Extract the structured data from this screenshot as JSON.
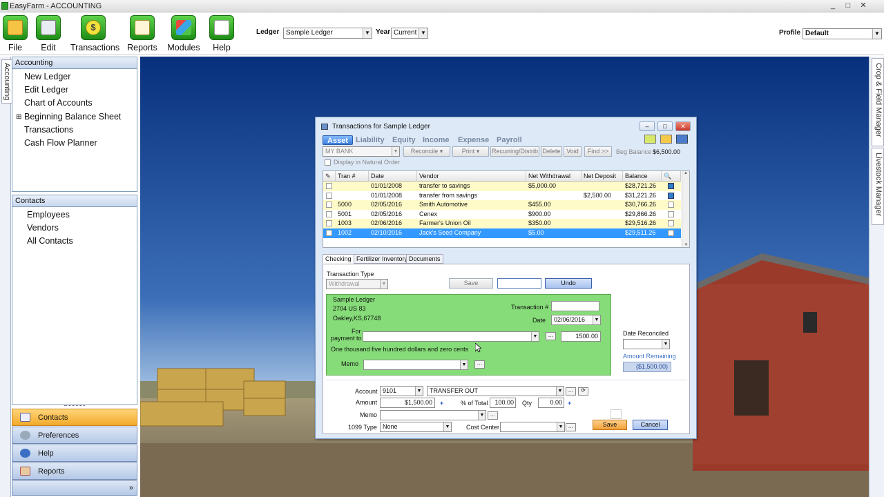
{
  "app": {
    "title": "EasyFarm - ACCOUNTING",
    "win_min": "_",
    "win_max": "□",
    "win_close": "✕"
  },
  "toolbar": {
    "buttons": [
      {
        "label": "File",
        "icon": "folder-icon"
      },
      {
        "label": "Edit",
        "icon": "clipboard-icon"
      },
      {
        "label": "Transactions",
        "icon": "dollar-icon"
      },
      {
        "label": "Reports",
        "icon": "report-icon"
      },
      {
        "label": "Modules",
        "icon": "cubes-icon"
      },
      {
        "label": "Help",
        "icon": "help-icon"
      }
    ],
    "ledger_label": "Ledger",
    "ledger_value": "Sample Ledger",
    "year_label": "Year",
    "year_value": "Current",
    "profile_label": "Profile",
    "profile_value": "Default"
  },
  "left_tab": {
    "label": "Accounting"
  },
  "accounting_panel": {
    "header": "Accounting",
    "items": [
      "New Ledger",
      "Edit Ledger",
      "Chart of Accounts",
      "Beginning Balance Sheet",
      "Transactions",
      "Cash Flow Planner"
    ],
    "expander": "⊞"
  },
  "contacts_panel": {
    "header": "Contacts",
    "items": [
      "Employees",
      "Vendors",
      "All Contacts"
    ]
  },
  "nav_buttons": [
    {
      "label": "Contacts",
      "active": true
    },
    {
      "label": "Preferences",
      "active": false
    },
    {
      "label": "Help",
      "active": false
    },
    {
      "label": "Reports",
      "active": false
    }
  ],
  "nav_more": "»",
  "right_tabs": [
    "Crop & Field Manager",
    "Livestock Manager"
  ],
  "dialog": {
    "title": "Transactions for Sample Ledger",
    "tabs": [
      "Asset",
      "Liability",
      "Equity",
      "Income",
      "Expense",
      "Payroll"
    ],
    "account_select": "MY BANK",
    "tool_buttons": [
      "Reconcile",
      "Print",
      "Recurring/Distrib",
      "Delete",
      "Void",
      "Find >>"
    ],
    "beg_balance_label": "Beg Balance",
    "beg_balance_value": "$6,500.00",
    "natural_order_label": "Display in Natural Order",
    "columns": [
      "Tran #",
      "Date",
      "Vendor",
      "Net Withdrawal",
      "Net Deposit",
      "Balance"
    ],
    "rows": [
      {
        "tran": "",
        "date": "01/01/2008",
        "vendor": "transfer to savings",
        "withdrawal": "$5,000.00",
        "deposit": "",
        "balance": "$28,721.26",
        "marked": true,
        "style": "yellow"
      },
      {
        "tran": "",
        "date": "01/01/2008",
        "vendor": "transfer from savings",
        "withdrawal": "",
        "deposit": "$2,500.00",
        "balance": "$31,221.26",
        "marked": true,
        "style": "white"
      },
      {
        "tran": "5000",
        "date": "02/05/2016",
        "vendor": "Smith Automotive",
        "withdrawal": "$455.00",
        "deposit": "",
        "balance": "$30,766.26",
        "marked": false,
        "style": "yellow"
      },
      {
        "tran": "5001",
        "date": "02/05/2016",
        "vendor": "Cenex",
        "withdrawal": "$900.00",
        "deposit": "",
        "balance": "$29,866.26",
        "marked": false,
        "style": "white"
      },
      {
        "tran": "1003",
        "date": "02/06/2016",
        "vendor": "Farmer's Union Oil",
        "withdrawal": "$350.00",
        "deposit": "",
        "balance": "$29,516.26",
        "marked": false,
        "style": "yellow"
      },
      {
        "tran": "1002",
        "date": "02/10/2016",
        "vendor": "Jack's Seed Company",
        "withdrawal": "$5.00",
        "deposit": "",
        "balance": "$29,511.26",
        "marked": false,
        "style": "selected"
      }
    ],
    "subtabs": [
      "Checking",
      "Fertilizer Inventory",
      "Documents"
    ],
    "transaction_type_label": "Transaction Type",
    "transaction_type_value": "Withdrawal",
    "save_top": "Save",
    "undo": "Undo",
    "check": {
      "name": "Sample Ledger",
      "address1": "2704 US 83",
      "address2": "Oakley,KS,67748",
      "transaction_no_label": "Transaction #",
      "transaction_no_value": "",
      "date_label": "Date",
      "date_value": "02/06/2016",
      "for_payment_label1": "For",
      "for_payment_label2": "payment to",
      "payee_value": "",
      "amount_value": "1500.00",
      "amount_words": "One thousand five hundred dollars and zero cents",
      "memo_label": "Memo",
      "memo_value": ""
    },
    "date_reconciled_label": "Date Reconciled",
    "amount_remaining_label": "Amount Remaining",
    "amount_remaining_value": "($1,500.00)",
    "dist": {
      "account_label": "Account",
      "account_no": "9101",
      "account_name": "TRANSFER OUT",
      "amount_label": "Amount",
      "amount_value": "$1,500.00",
      "pct_label": "% of Total",
      "pct_value": "100.00",
      "qty_label": "Qty",
      "qty_value": "0.00",
      "memo_label": "Memo",
      "type1099_label": "1099 Type",
      "type1099_value": "None",
      "cost_center_label": "Cost Center"
    },
    "save": "Save",
    "cancel": "Cancel"
  }
}
